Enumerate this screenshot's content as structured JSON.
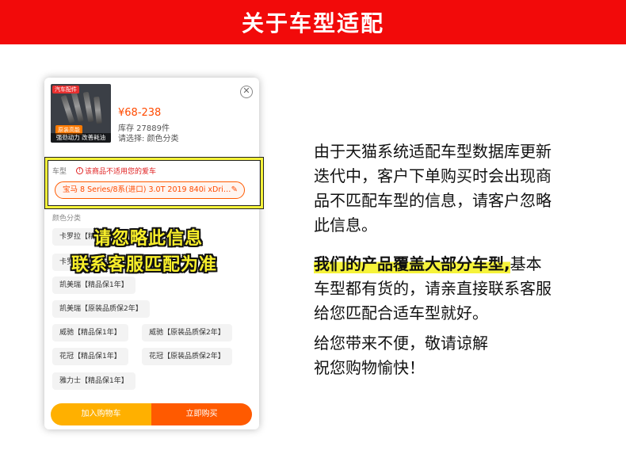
{
  "banner": {
    "title": "关于车型适配"
  },
  "product": {
    "thumb_tag": "汽车配件",
    "thumb_badge": "原装高能",
    "thumb_caption": "强劲动力 改善耗油",
    "price": "¥68-238",
    "stock": "库存 27889件",
    "selected": "请选择: 颜色分类"
  },
  "car": {
    "label": "车型",
    "warning": "该商品不适用您的爱车",
    "selected_model": "宝马 8 Series/8系(进口) 3.0T 2019 840i xDri…"
  },
  "color": {
    "label": "颜色分类",
    "options": [
      "卡罗拉【精品保1年】",
      "卡罗拉【原装品质保2年】",
      "凯美瑞【精品保1年】",
      "凯美瑞【原装品质保2年】",
      "威驰【精品保1年】",
      "威驰【原装品质保2年】",
      "花冠【精品保1年】",
      "花冠【原装品质保2年】",
      "雅力士【精品保1年】"
    ]
  },
  "actions": {
    "add_to_cart": "加入购物车",
    "buy_now": "立即购买"
  },
  "overlay": {
    "line1": "请忽略此信息",
    "line2": "联系客服匹配为准"
  },
  "notice": {
    "p1": [
      "由于天猫系统适配车型数据库更新",
      "迭代中，客户下单购买时会出现商",
      "品不匹配车型的信息，请客户忽略",
      "此信息。"
    ],
    "p2_highlight": "我们的产品覆盖大部分车型,",
    "p2_rest": [
      "基本",
      "车型都有货的，请亲直接联系客服",
      "给您匹配合适车型就好。"
    ],
    "p3": [
      "给您带来不便，敬请谅解",
      "祝您购物愉快！"
    ]
  },
  "colors": {
    "banner": "#f20a0a",
    "accent_orange": "#ff5a00",
    "accent_yellow": "#ffb000",
    "highlight": "#f6f33a"
  }
}
